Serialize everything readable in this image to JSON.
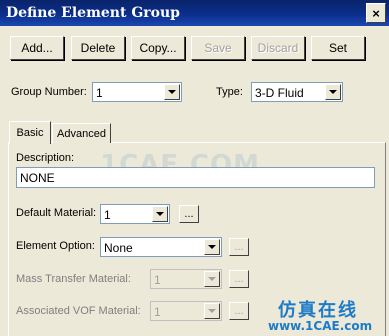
{
  "window": {
    "title": "Define Element Group",
    "close_glyph": "×"
  },
  "toolbar": {
    "add": "Add...",
    "delete": "Delete",
    "copy": "Copy...",
    "save": "Save",
    "discard": "Discard",
    "set": "Set"
  },
  "group": {
    "number_label": "Group Number:",
    "number_value": "1",
    "type_label": "Type:",
    "type_value": "3-D Fluid"
  },
  "tabs": {
    "basic": "Basic",
    "advanced": "Advanced"
  },
  "form": {
    "description_label": "Description:",
    "description_value": "NONE",
    "default_material_label": "Default Material:",
    "default_material_value": "1",
    "element_option_label": "Element Option:",
    "element_option_value": "None",
    "mass_transfer_label": "Mass Transfer Material:",
    "mass_transfer_value": "1",
    "vof_label": "Associated VOF Material:",
    "vof_value": "1",
    "ellipsis": "..."
  },
  "watermark": {
    "center": "1CAE.COM",
    "brand_cn": "仿真在线",
    "brand_url": "www.1CAE.com"
  }
}
